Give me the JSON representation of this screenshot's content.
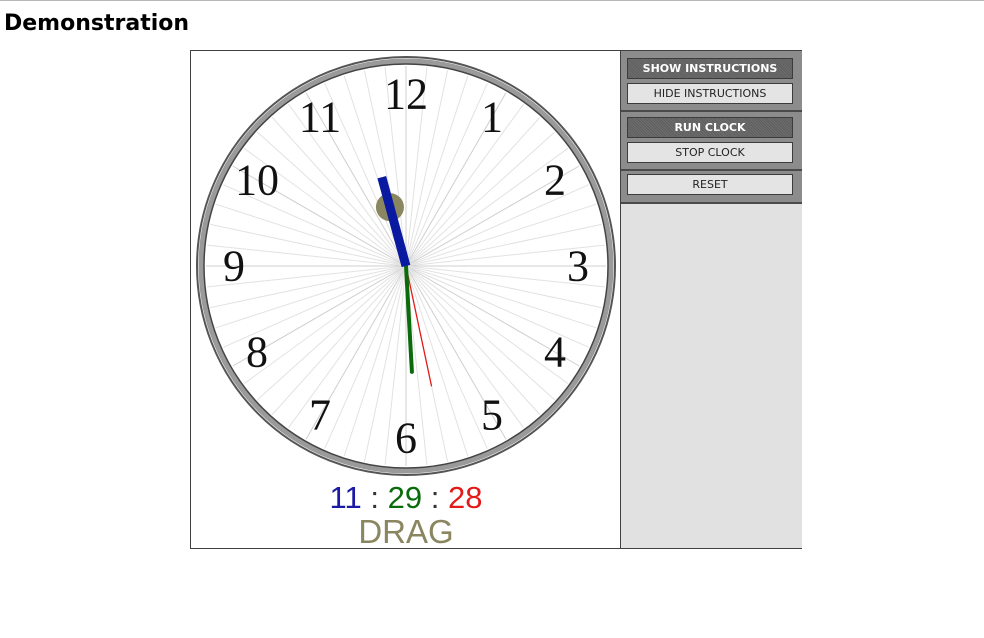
{
  "page": {
    "heading": "Demonstration"
  },
  "clock": {
    "numerals": [
      "12",
      "1",
      "2",
      "3",
      "4",
      "5",
      "6",
      "7",
      "8",
      "9",
      "10",
      "11"
    ],
    "time": {
      "hours": "11",
      "minutes": "29",
      "seconds": "28"
    },
    "separator": ":",
    "drag_label": "DRAG",
    "colors": {
      "hour_hand": "#0a1aa0",
      "minute_hand": "#0a6b0a",
      "second_hand": "#e31a1a",
      "drag_handle": "#8a8660"
    }
  },
  "controls": {
    "show_instructions": "SHOW INSTRUCTIONS",
    "hide_instructions": "HIDE INSTRUCTIONS",
    "run_clock": "RUN CLOCK",
    "stop_clock": "STOP CLOCK",
    "reset": "RESET"
  }
}
